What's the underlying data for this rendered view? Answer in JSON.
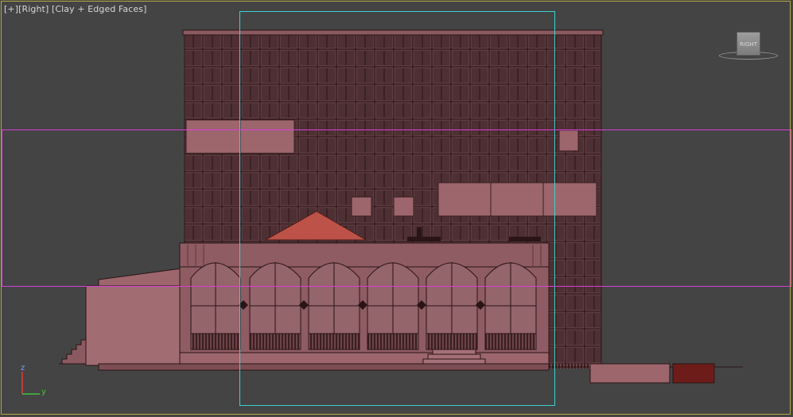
{
  "viewport": {
    "label_plus": "[+]",
    "label_view": "[Right]",
    "label_shading": "[Clay + Edged Faces]",
    "frame_color": "#b9a542",
    "background": "#444444"
  },
  "viewcube": {
    "face_label": "RIGHT"
  },
  "axis_gizmo": {
    "z_label": "z",
    "y_label": "y",
    "z_color": "#e23b3b",
    "y_color": "#3fc23f"
  },
  "colors": {
    "clay_face": "#875960",
    "clay_dark": "#5a3a3e",
    "clay_edge": "#2a1416",
    "clay_light": "#a57077",
    "roof_red": "#bd5248",
    "accent_dark_red": "#6e1c1a",
    "safe_frame_cyan": "#3fcfd2",
    "safe_frame_magenta": "#d63fd6"
  }
}
